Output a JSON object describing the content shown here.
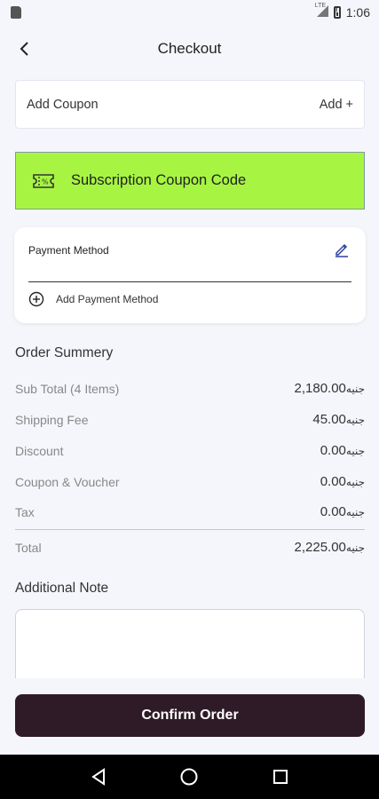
{
  "status_bar": {
    "time": "1:06",
    "network_label": "LTE"
  },
  "header": {
    "title": "Checkout"
  },
  "coupon": {
    "label": "Add Coupon",
    "action": "Add +"
  },
  "subscription_coupon": {
    "label": "Subscription Coupon Code",
    "background": "#a7f542"
  },
  "payment": {
    "title": "Payment Method",
    "add_label": "Add Payment Method",
    "accent": "#2f3f9e"
  },
  "order_summary": {
    "title": "Order Summery",
    "rows": [
      {
        "label": "Sub Total  (4 Items)",
        "amount": "2,180.00",
        "currency": "جنيه"
      },
      {
        "label": "Shipping Fee",
        "amount": "45.00",
        "currency": "جنيه"
      },
      {
        "label": "Discount",
        "amount": "0.00",
        "currency": "جنيه"
      },
      {
        "label": "Coupon & Voucher",
        "amount": "0.00",
        "currency": "جنيه"
      },
      {
        "label": "Tax",
        "amount": "0.00",
        "currency": "جنيه"
      }
    ],
    "total": {
      "label": "Total",
      "amount": "2,225.00",
      "currency": "جنيه"
    }
  },
  "additional_note": {
    "title": "Additional Note",
    "value": ""
  },
  "confirm": {
    "label": "Confirm Order",
    "background": "#2e1b27"
  }
}
